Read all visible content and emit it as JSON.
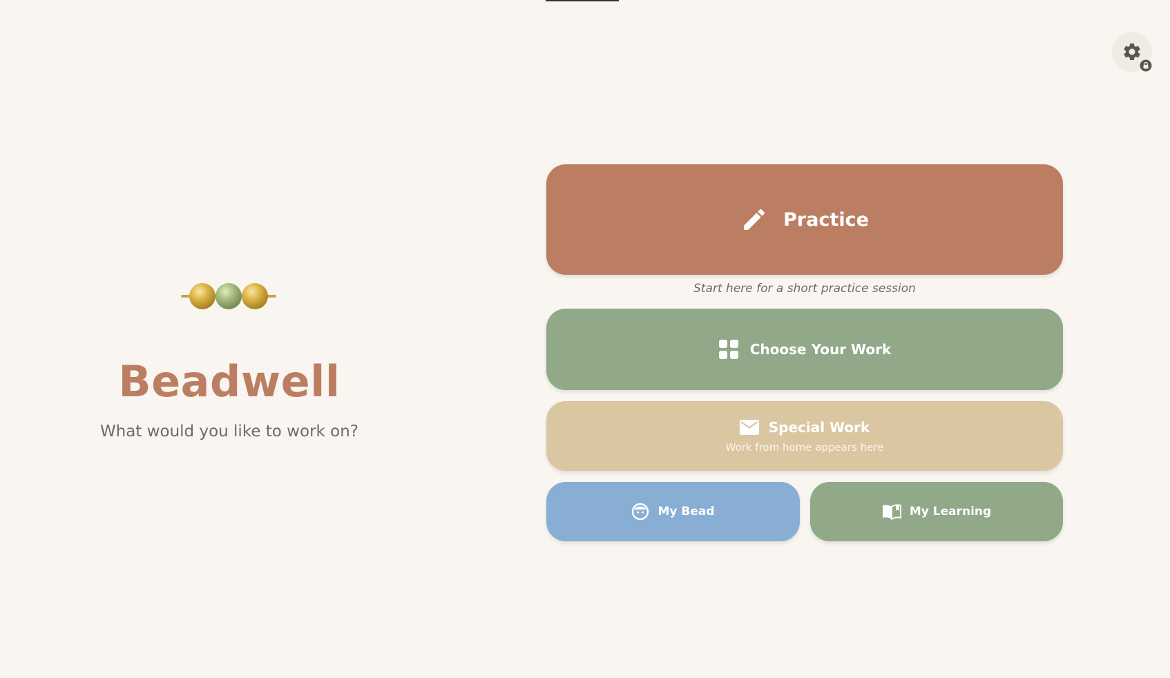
{
  "app": {
    "title": "Beadwell",
    "subtitle": "What would you like to work on?"
  },
  "settings": {
    "icon": "gear-icon",
    "badge_icon": "lock-icon"
  },
  "menu": {
    "practice": {
      "label": "Practice",
      "hint": "Start here for a short practice session",
      "icon": "pencil-icon",
      "color": "#bc7e62"
    },
    "choose_work": {
      "label": "Choose Your Work",
      "icon": "grid-icon",
      "color": "#91a889"
    },
    "special_work": {
      "label": "Special Work",
      "description": "Work from home appears here",
      "icon": "envelope-icon",
      "color": "#dbc6a2"
    },
    "my_bead": {
      "label": "My Bead",
      "icon": "face-icon",
      "color": "#88aed3"
    },
    "my_learning": {
      "label": "My Learning",
      "icon": "book-icon",
      "color": "#91a889"
    }
  },
  "colors": {
    "background": "#f9f6f1",
    "brand": "#bc7e62",
    "text_muted": "#6f6a66"
  }
}
